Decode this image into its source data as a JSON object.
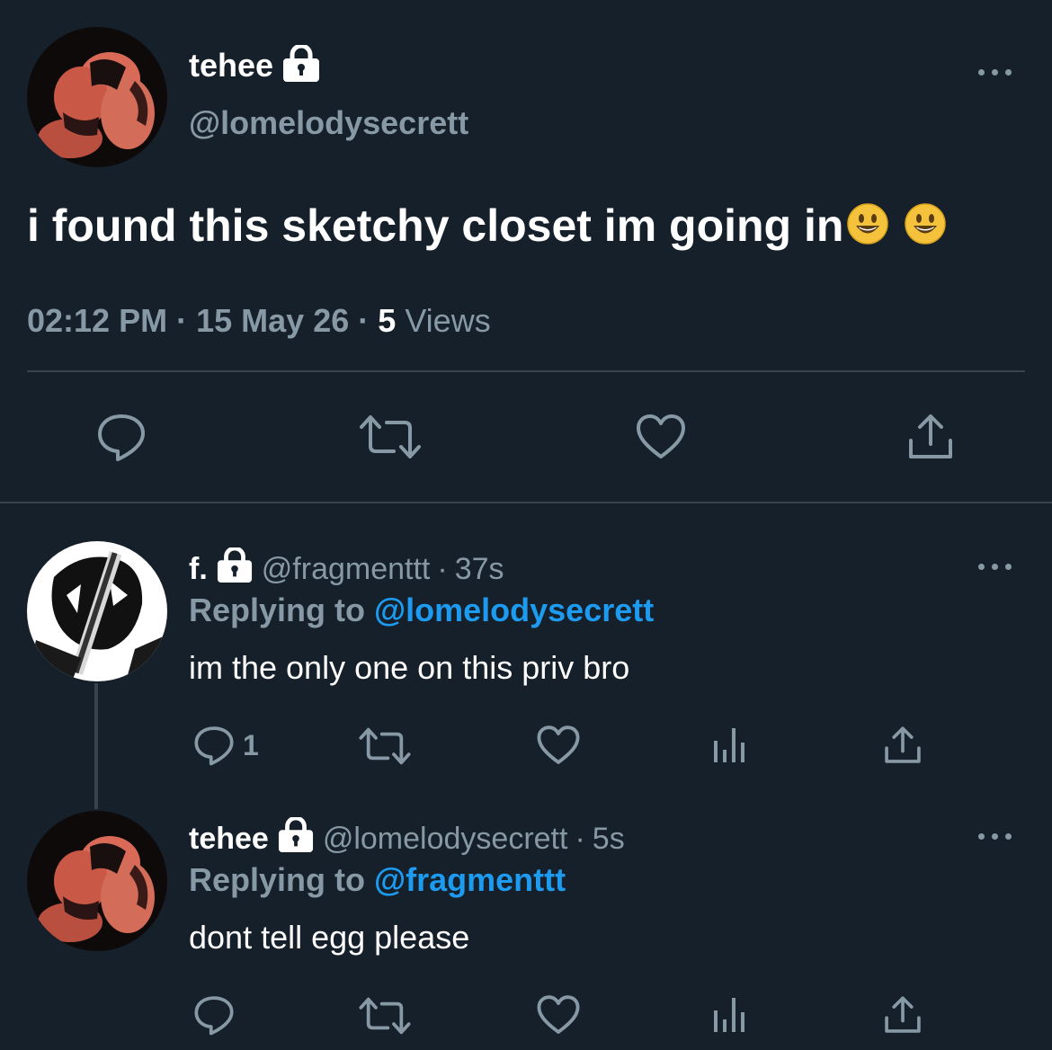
{
  "main_tweet": {
    "display_name": "tehee",
    "handle": "@lomelodysecrett",
    "text": "i found this sketchy closet im going in",
    "time": "02:12 PM",
    "date": "15 May 26",
    "views_count": "5",
    "views_label": "Views",
    "separator": "·"
  },
  "replies": [
    {
      "display_name": "f.",
      "handle": "@fragmenttt",
      "age": "37s",
      "separator": "·",
      "replying_label": "Replying to",
      "replying_to": "@lomelodysecrett",
      "text": "im the only one on this priv bro",
      "reply_count": "1"
    },
    {
      "display_name": "tehee",
      "handle": "@lomelodysecrett",
      "age": "5s",
      "separator": "·",
      "replying_label": "Replying to",
      "replying_to": "@fragmenttt",
      "text": "dont tell egg please",
      "reply_count": ""
    }
  ],
  "colors": {
    "background": "#15202b",
    "muted": "#8899a6",
    "link": "#1d9bf0",
    "divider": "#38444d"
  },
  "icons": [
    "lock-icon",
    "more-icon",
    "reply-icon",
    "retweet-icon",
    "like-icon",
    "share-icon",
    "analytics-icon",
    "smiley-emoji"
  ]
}
